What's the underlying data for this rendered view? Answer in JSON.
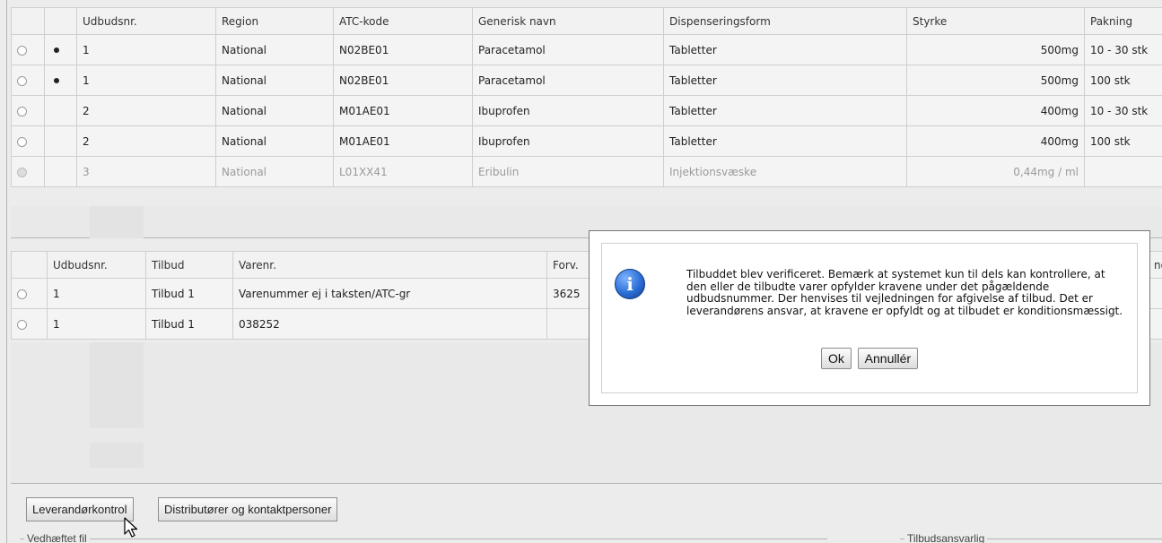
{
  "upper_table": {
    "headers": [
      "",
      "",
      "Udbudsnr.",
      "Region",
      "ATC-kode",
      "Generisk navn",
      "Dispenseringsform",
      "Styrke",
      "Pakning"
    ],
    "rows": [
      {
        "selected_dot": true,
        "udbudsnr": "1",
        "region": "National",
        "atc": "N02BE01",
        "generisk": "Paracetamol",
        "form": "Tabletter",
        "styrke": "500mg",
        "pakning": "10 - 30 stk",
        "muted": false
      },
      {
        "selected_dot": true,
        "udbudsnr": "1",
        "region": "National",
        "atc": "N02BE01",
        "generisk": "Paracetamol",
        "form": "Tabletter",
        "styrke": "500mg",
        "pakning": "100 stk",
        "muted": false
      },
      {
        "selected_dot": false,
        "udbudsnr": "2",
        "region": "National",
        "atc": "M01AE01",
        "generisk": "Ibuprofen",
        "form": "Tabletter",
        "styrke": "400mg",
        "pakning": "10 - 30 stk",
        "muted": false
      },
      {
        "selected_dot": false,
        "udbudsnr": "2",
        "region": "National",
        "atc": "M01AE01",
        "generisk": "Ibuprofen",
        "form": "Tabletter",
        "styrke": "400mg",
        "pakning": "100 stk",
        "muted": false
      },
      {
        "selected_dot": false,
        "udbudsnr": "3",
        "region": "National",
        "atc": "L01XX41",
        "generisk": "Eribulin",
        "form": "Injektionsvæske",
        "styrke": "0,44mg / ml",
        "pakning": "",
        "muted": true
      }
    ]
  },
  "lower_table": {
    "headers": [
      "",
      "Udbudsnr.",
      "Tilbud",
      "Varenr.",
      "Forv.",
      "",
      "ngs"
    ],
    "rows": [
      {
        "udbudsnr": "1",
        "tilbud": "Tilbud 1",
        "varenr": "Varenummer ej i taksten/ATC-gr",
        "forv": "3625"
      },
      {
        "udbudsnr": "1",
        "tilbud": "Tilbud 1",
        "varenr": "038252",
        "forv": ""
      }
    ]
  },
  "dialog": {
    "icon": "info-icon",
    "message": "Tilbuddet blev verificeret. Bemærk at systemet kun til dels kan kontrollere, at den eller de tilbudte varer opfylder kravene under det pågældende udbudsnummer. Der henvises til vejledningen for afgivelse af tilbud. Det er leverandørens ansvar, at kravene er opfyldt og at tilbudet er konditionsmæssigt.",
    "ok_label": "Ok",
    "cancel_label": "Annullér"
  },
  "bottom_buttons": {
    "leverandorkontrol": "Leverandørkontrol",
    "distributorer": "Distributører og kontaktpersoner"
  },
  "fieldsets": {
    "vedhaeftet": "Vedhæftet fil",
    "tilbudsansvarlig": "Tilbudsansvarlig"
  }
}
